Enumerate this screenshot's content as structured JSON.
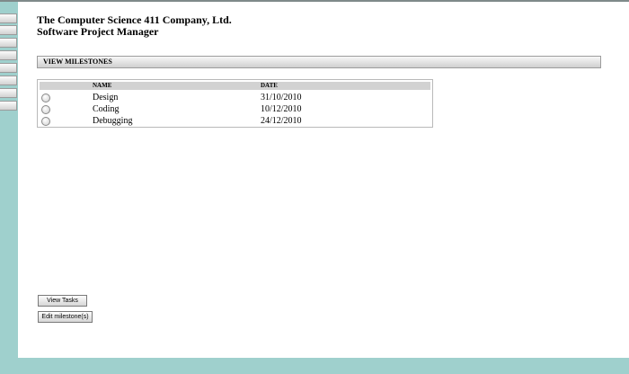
{
  "header": {
    "company": "The Computer Science 411 Company, Ltd.",
    "app_name": "Software Project Manager"
  },
  "section": {
    "title": "VIEW MILESTONES"
  },
  "table": {
    "columns": [
      "NAME",
      "DATE"
    ],
    "rows": [
      {
        "name": "Design",
        "date": "31/10/2010"
      },
      {
        "name": "Coding",
        "date": "10/12/2010"
      },
      {
        "name": "Debugging",
        "date": "24/12/2010"
      }
    ]
  },
  "buttons": {
    "view_tasks": "View Tasks",
    "edit_milestones": "Edit milestone(s)"
  },
  "colors": {
    "background": "#9fd0cd",
    "panel": "#ffffff"
  }
}
